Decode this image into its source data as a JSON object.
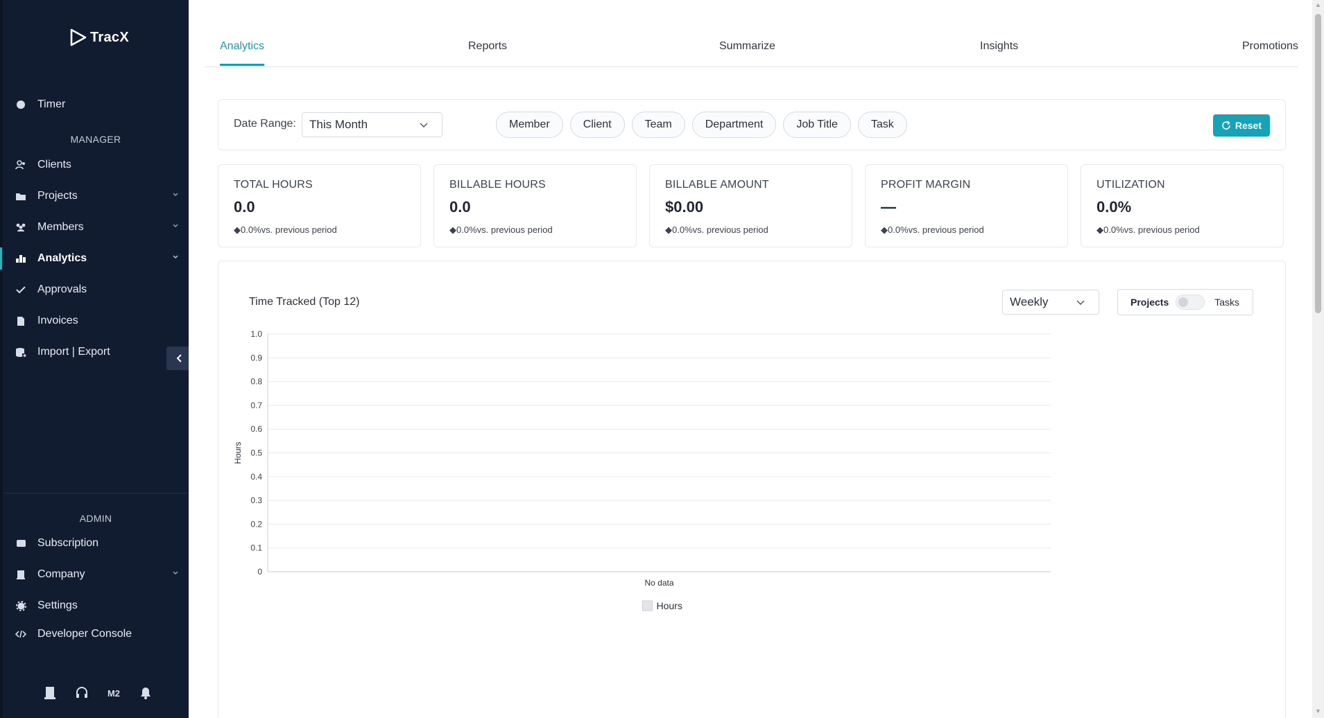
{
  "app": {
    "name": "TracX"
  },
  "sidebar": {
    "items": [
      {
        "label": "Timer",
        "icon": "dot-icon"
      },
      {
        "label": "Clients",
        "icon": "users-icon"
      },
      {
        "label": "Projects",
        "icon": "folder-icon"
      },
      {
        "label": "Members",
        "icon": "members-icon"
      },
      {
        "label": "Analytics",
        "icon": "analytics-icon"
      },
      {
        "label": "Approvals",
        "icon": "check-icon"
      },
      {
        "label": "Invoices",
        "icon": "file-icon"
      },
      {
        "label": "Import | Export",
        "icon": "database-icon"
      },
      {
        "label": "Subscription",
        "icon": "credit-card-icon"
      },
      {
        "label": "Company",
        "icon": "building-icon"
      },
      {
        "label": "Settings",
        "icon": "gear-icon"
      },
      {
        "label": "Developer Console",
        "icon": "code-icon"
      }
    ],
    "sections": {
      "manager": "MANAGER",
      "admin": "ADMIN"
    },
    "active": "Analytics",
    "user_initials": "M2"
  },
  "tabs": [
    {
      "label": "Analytics"
    },
    {
      "label": "Reports"
    },
    {
      "label": "Summarize"
    },
    {
      "label": "Insights"
    },
    {
      "label": "Promotions"
    }
  ],
  "filters": {
    "date_range_label": "Date Range:",
    "date_range_value": "This Month",
    "pills": [
      "Member",
      "Client",
      "Team",
      "Department",
      "Job Title",
      "Task"
    ],
    "reset_label": "Reset"
  },
  "kpis": [
    {
      "title": "TOTAL HOURS",
      "value": "0.0",
      "delta": "◆0.0%vs. previous period"
    },
    {
      "title": "BILLABLE HOURS",
      "value": "0.0",
      "delta": "◆0.0%vs. previous period"
    },
    {
      "title": "BILLABLE AMOUNT",
      "value": "$0.00",
      "delta": "◆0.0%vs. previous period"
    },
    {
      "title": "PROFIT MARGIN",
      "value": "—",
      "delta": "◆0.0%vs. previous period"
    },
    {
      "title": "UTILIZATION",
      "value": "0.0%",
      "delta": "◆0.0%vs. previous period"
    }
  ],
  "chart_panel": {
    "title": "Time Tracked (Top 12)",
    "interval": "Weekly",
    "toggle_left": "Projects",
    "toggle_right": "Tasks"
  },
  "chart_data": {
    "type": "bar",
    "categories": [
      "No data"
    ],
    "series": [
      {
        "name": "Hours",
        "values": [
          0
        ]
      }
    ],
    "ylabel": "Hours",
    "ylim": [
      0,
      1
    ],
    "yticks": [
      "0",
      "0.1",
      "0.2",
      "0.3",
      "0.4",
      "0.5",
      "0.6",
      "0.7",
      "0.8",
      "0.9",
      "1.0"
    ],
    "grid": true,
    "legend": "bottom",
    "series_color": "#e3e5e8"
  },
  "colors": {
    "accent": "#17a2b8",
    "sidebar_bg": "#121c30"
  }
}
